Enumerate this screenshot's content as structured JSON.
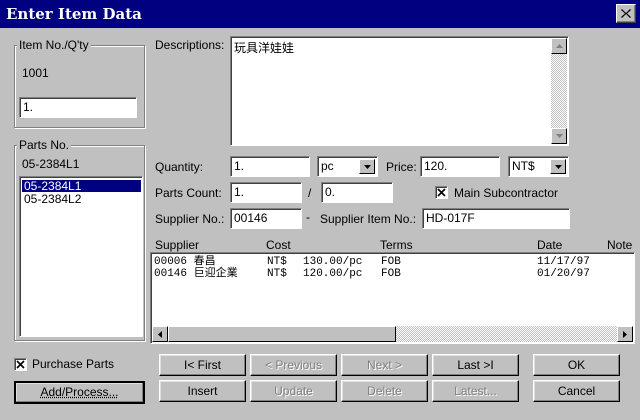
{
  "window": {
    "title": "Enter Item Data"
  },
  "item_group": {
    "legend": "Item No./Q'ty",
    "item_no": "1001",
    "qty_value": "1."
  },
  "parts_group": {
    "legend": "Parts No.",
    "current_part": "05-2384L1",
    "parts": [
      "05-2384L1",
      "05-2384L2"
    ],
    "selected_index": 0
  },
  "descriptions": {
    "label": "Descriptions:",
    "value": "玩具洋娃娃"
  },
  "quantity": {
    "label": "Quantity:",
    "value": "1.",
    "unit": "pc"
  },
  "price": {
    "label": "Price:",
    "value": "120.",
    "currency": "NT$"
  },
  "parts_count": {
    "label": "Parts Count:",
    "value": "1.",
    "separator": "/",
    "total": "0."
  },
  "main_subcontractor": {
    "label": "Main Subcontractor",
    "checked": true
  },
  "supplier": {
    "label": "Supplier No.:",
    "value": "00146",
    "dash": "-",
    "item_label": "Supplier Item No.:",
    "item_value": "HD-017F"
  },
  "supplier_table": {
    "columns": [
      "Supplier",
      "Cost",
      "Terms",
      "Date",
      "Note"
    ],
    "rows": [
      {
        "supplier": "00006 春昌",
        "currency": "NT$",
        "cost": "130.00/pc",
        "terms": "FOB",
        "date": "11/17/97"
      },
      {
        "supplier": "00146 巨迎企業",
        "currency": "NT$",
        "cost": "120.00/pc",
        "terms": "FOB",
        "date": "01/20/97"
      }
    ]
  },
  "purchase_parts": {
    "label": "Purchase Parts",
    "checked": true
  },
  "buttons": {
    "add_process": "Add/Process...",
    "first": "I< First",
    "previous": "< Previous",
    "next": "Next >",
    "last": "Last >I",
    "ok": "OK",
    "insert": "Insert",
    "update": "Update",
    "delete": "Delete",
    "latest": "Latest...",
    "cancel": "Cancel"
  },
  "colors": {
    "titlebar": "#000080",
    "face": "#c0c0c0",
    "selection": "#000080"
  },
  "icons": {
    "close": "close-icon",
    "dropdown": "dropdown-arrow-icon",
    "scroll_up": "scroll-up-arrow-icon",
    "scroll_down": "scroll-down-arrow-icon",
    "scroll_left": "scroll-left-arrow-icon",
    "scroll_right": "scroll-right-arrow-icon",
    "check": "check-x-icon"
  }
}
